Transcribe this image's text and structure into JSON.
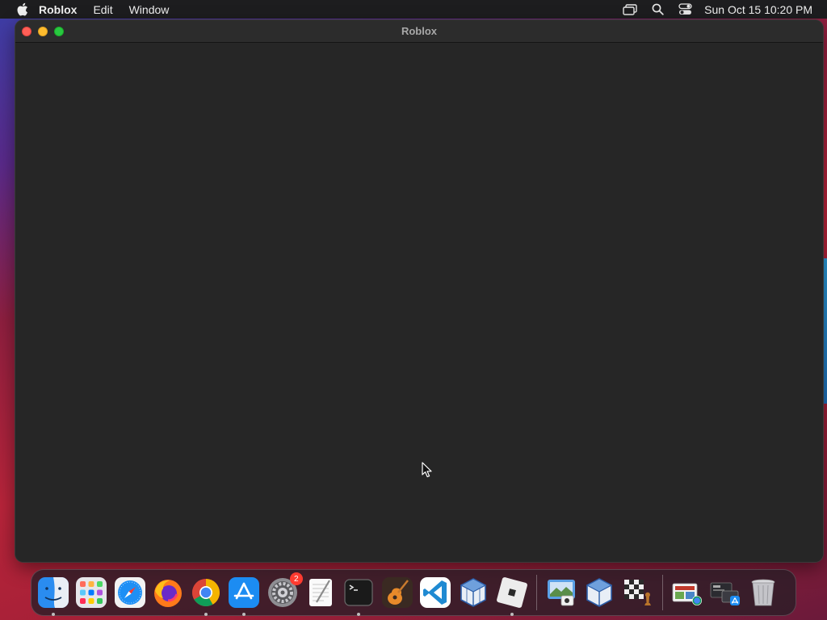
{
  "menubar": {
    "app_name": "Roblox",
    "items": [
      "Edit",
      "Window"
    ],
    "clock": "Sun Oct 15  10:20 PM"
  },
  "window": {
    "title": "Roblox"
  },
  "dock": {
    "apps": [
      {
        "name": "Finder",
        "icon": "finder-icon",
        "running": true
      },
      {
        "name": "Launchpad",
        "icon": "launchpad-icon",
        "running": false
      },
      {
        "name": "Safari",
        "icon": "safari-icon",
        "running": false
      },
      {
        "name": "Firefox",
        "icon": "firefox-icon",
        "running": false
      },
      {
        "name": "Google Chrome",
        "icon": "chrome-icon",
        "running": true
      },
      {
        "name": "App Store",
        "icon": "app-store-icon",
        "running": true
      },
      {
        "name": "System Settings",
        "icon": "system-settings-icon",
        "running": false,
        "badge": "2"
      },
      {
        "name": "TextEdit",
        "icon": "textedit-icon",
        "running": false
      },
      {
        "name": "Terminal",
        "icon": "terminal-icon",
        "running": true
      },
      {
        "name": "GarageBand",
        "icon": "garageband-icon",
        "running": false
      },
      {
        "name": "Visual Studio Code",
        "icon": "vscode-icon",
        "running": false
      },
      {
        "name": "VirtualBox",
        "icon": "virtualbox-icon",
        "running": false
      },
      {
        "name": "Roblox",
        "icon": "roblox-icon",
        "running": true
      }
    ],
    "recent": [
      {
        "name": "Preview",
        "icon": "preview-icon"
      },
      {
        "name": "VirtualBox",
        "icon": "virtualbox-icon"
      },
      {
        "name": "Chess",
        "icon": "chess-icon"
      }
    ],
    "stacks": [
      {
        "name": "Downloads",
        "icon": "downloads-stack-icon"
      },
      {
        "name": "Applications",
        "icon": "applications-stack-icon"
      },
      {
        "name": "Trash",
        "icon": "trash-icon"
      }
    ]
  },
  "colors": {
    "menubar_bg": "#1d1d1f",
    "window_bg": "#262626",
    "close": "#ff5f57",
    "minimize": "#febc2e",
    "maximize": "#28c840"
  }
}
